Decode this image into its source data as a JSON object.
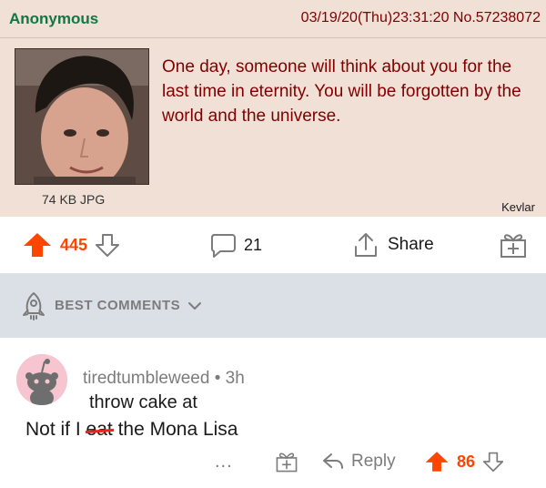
{
  "post": {
    "name": "Anonymous",
    "meta": "03/19/20(Thu)23:31:20 No.57238072",
    "text": "One day, someone will think about you for the last time in eternity. You will be forgotten by the world and the universe.",
    "file_info": "74 KB JPG",
    "watermark": "Kevlar"
  },
  "actions": {
    "upvotes": "445",
    "comments": "21",
    "share_label": "Share"
  },
  "sort": {
    "label": "BEST COMMENTS"
  },
  "comment": {
    "username": "tiredtumbleweed",
    "separator": "•",
    "age": "3h",
    "line1": "throw cake at",
    "line2_before": "Not if I ",
    "line2_struck": "eat",
    "line2_after": " the Mona Lisa",
    "more": "...",
    "reply_label": "Reply",
    "votes": "86"
  },
  "colors": {
    "upvote": "#ff4500",
    "chan_name": "#117743",
    "chan_text": "#800000",
    "chan_bg": "#f0e0d6",
    "sort_bg": "#dae0e6",
    "strike": "#e8251b"
  }
}
